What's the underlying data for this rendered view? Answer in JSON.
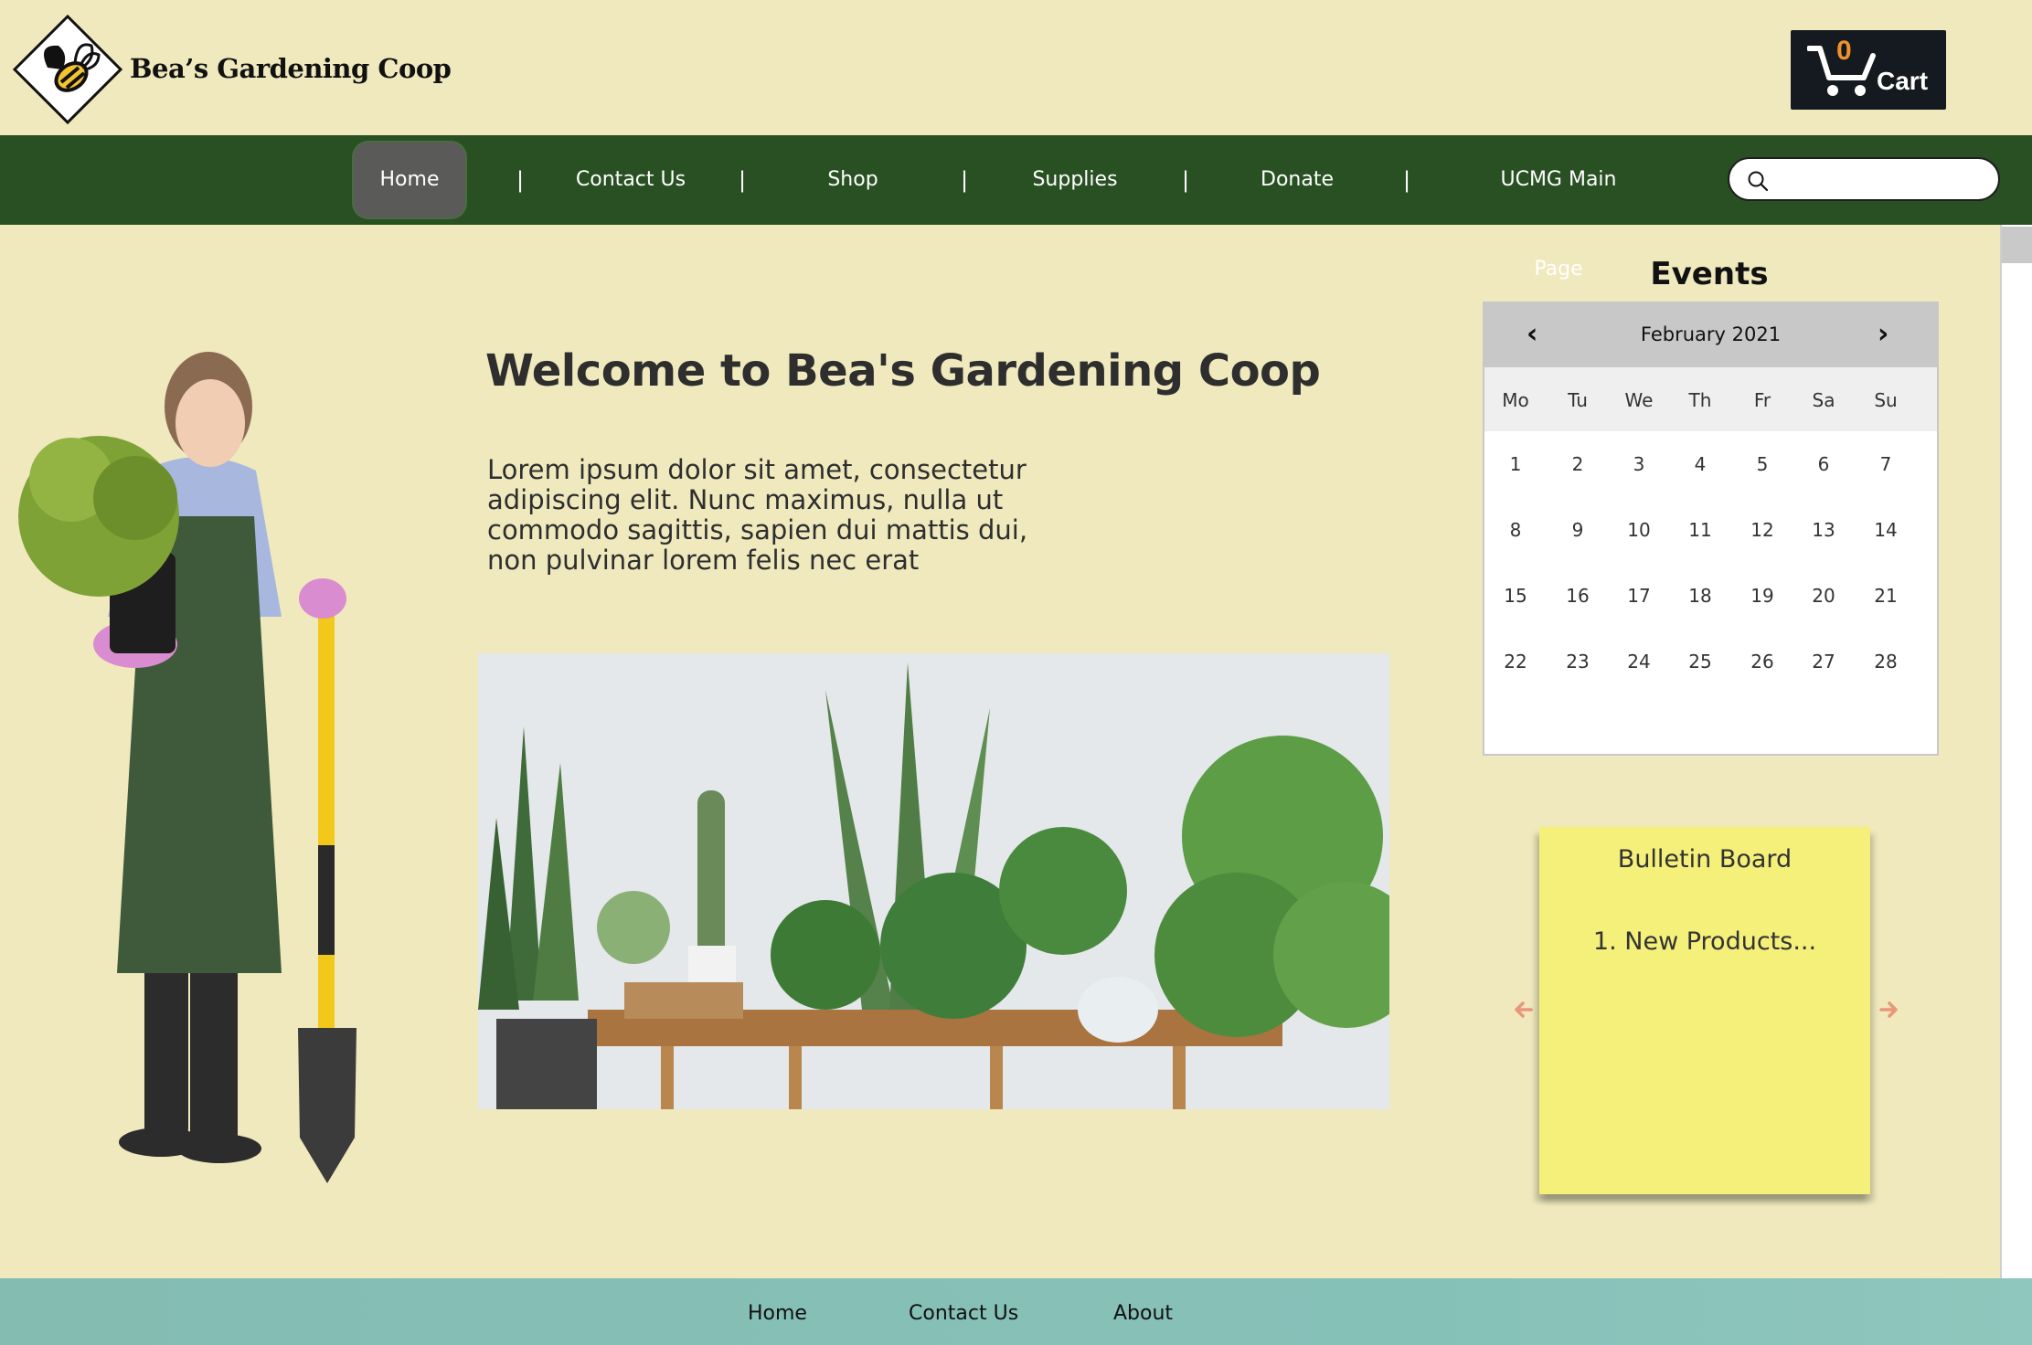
{
  "header": {
    "brand": "Bea’s Gardening Coop",
    "cart": {
      "count": "0",
      "label": "Cart"
    }
  },
  "nav": {
    "items": [
      "Home",
      "Contact Us",
      "Shop",
      "Supplies",
      "Donate",
      "UCMG Main Page"
    ],
    "separator": "|",
    "active": "Home",
    "search_placeholder": ""
  },
  "main": {
    "title": "Welcome to Bea's Gardening Coop",
    "intro": "Lorem ipsum dolor sit amet, consectetur adipiscing elit. Nunc maximus, nulla ut commodo sagittis, sapien dui mattis dui, non pulvinar lorem felis nec erat"
  },
  "events": {
    "title": "Events",
    "month": "February 2021",
    "weekdays": [
      "Mo",
      "Tu",
      "We",
      "Th",
      "Fr",
      "Sa",
      "Su"
    ],
    "weeks": [
      [
        "1",
        "2",
        "3",
        "4",
        "5",
        "6",
        "7"
      ],
      [
        "8",
        "9",
        "10",
        "11",
        "12",
        "13",
        "14"
      ],
      [
        "15",
        "16",
        "17",
        "18",
        "19",
        "20",
        "21"
      ],
      [
        "22",
        "23",
        "24",
        "25",
        "26",
        "27",
        "28"
      ]
    ]
  },
  "bulletin": {
    "title": "Bulletin Board",
    "item": "1. New Products..."
  },
  "footer": {
    "links": [
      "Home",
      "Contact Us",
      "About"
    ]
  },
  "colors": {
    "page_bg": "#efe9bd",
    "nav_bg": "#285022",
    "cart_bg": "#141a1f",
    "cart_count": "#f0912c",
    "bulletin_bg": "#f4f07a",
    "footer_bg": "#84bcb2",
    "arrow": "#e8977a"
  },
  "icons": {
    "logo": "bee-diamond-logo",
    "cart": "shopping-cart-icon",
    "search": "search-icon",
    "prev": "chevron-left-icon",
    "next": "chevron-right-icon"
  }
}
